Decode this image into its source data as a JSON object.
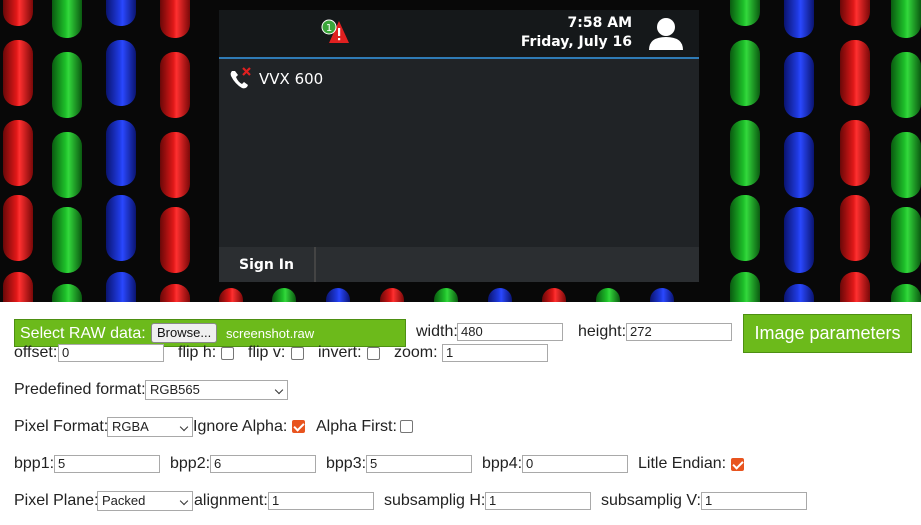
{
  "phone": {
    "alert_count": "1",
    "time": "7:58 AM",
    "date": "Friday, July 16",
    "line_label": "VVX 600",
    "softkey_1": "Sign In"
  },
  "form": {
    "select_raw_label": "Select RAW data:",
    "browse_label": "Browse...",
    "file_name": "screenshot.raw",
    "width_label": "width:",
    "width_value": "480",
    "height_label": "height:",
    "height_value": "272",
    "image_params_label": "Image parameters",
    "offset_label": "offset:",
    "offset_value": "0",
    "flip_h_label": "flip h:",
    "flip_h": false,
    "flip_v_label": "flip v:",
    "flip_v": false,
    "invert_label": "invert:",
    "invert": false,
    "zoom_label": "zoom:",
    "zoom_value": "1",
    "predefined_label": "Predefined format:",
    "predefined_value": "RGB565",
    "pixel_format_label": "Pixel Format:",
    "pixel_format_value": "RGBA",
    "ignore_alpha_label": "Ignore Alpha:",
    "ignore_alpha": true,
    "alpha_first_label": "Alpha First:",
    "alpha_first": false,
    "bpp1_label": "bpp1:",
    "bpp1_value": "5",
    "bpp2_label": "bpp2:",
    "bpp2_value": "6",
    "bpp3_label": "bpp3:",
    "bpp3_value": "5",
    "bpp4_label": "bpp4:",
    "bpp4_value": "0",
    "little_endian_label": "Litle Endian:",
    "little_endian": true,
    "pixel_plane_label": "Pixel Plane:",
    "pixel_plane_value": "Packed",
    "alignment_label": "alignment:",
    "alignment_value": "1",
    "subsampling_h_label": "subsamplig H:",
    "subsampling_h_value": "1",
    "subsampling_v_label": "subsamplig V:",
    "subsampling_v_value": "1"
  },
  "colors": {
    "accent_green": "#6cba1b",
    "checkbox_orange": "#e8541f",
    "phone_divider_blue": "#2f7bb6"
  }
}
